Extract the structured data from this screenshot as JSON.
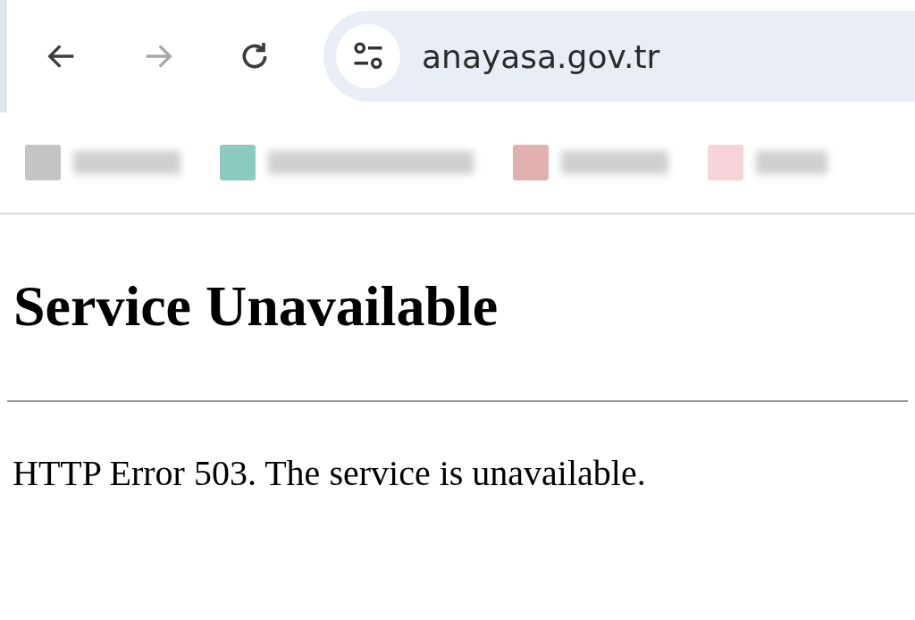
{
  "toolbar": {
    "nav_buttons": [
      {
        "kind": "back",
        "disabled": false
      },
      {
        "kind": "forward",
        "disabled": true
      },
      {
        "kind": "reload",
        "disabled": false
      }
    ],
    "address_bar": {
      "url": "anayasa.gov.tr"
    }
  },
  "bookmarks": [
    {
      "color": "#c4c4c4"
    },
    {
      "color": "#8ccbbf"
    },
    {
      "color": "#e3b0b0"
    },
    {
      "color": "#f6d3d8"
    }
  ],
  "page": {
    "heading": "Service Unavailable",
    "message": "HTTP Error 503. The service is unavailable."
  }
}
